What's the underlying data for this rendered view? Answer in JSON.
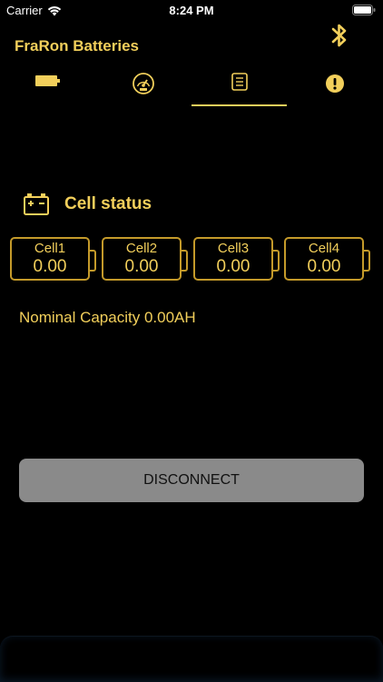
{
  "status_bar": {
    "carrier": "Carrier",
    "time": "8:24 PM"
  },
  "app": {
    "title": "FraRon Batteries"
  },
  "tabs": [
    {
      "icon": "battery-icon",
      "selected": false
    },
    {
      "icon": "gauge-icon",
      "selected": false
    },
    {
      "icon": "list-icon",
      "selected": true
    },
    {
      "icon": "alert-icon",
      "selected": false
    }
  ],
  "cell_status": {
    "title": "Cell status",
    "cells": [
      {
        "label": "Cell1",
        "value": "0.00"
      },
      {
        "label": "Cell2",
        "value": "0.00"
      },
      {
        "label": "Cell3",
        "value": "0.00"
      },
      {
        "label": "Cell4",
        "value": "0.00"
      }
    ]
  },
  "nominal_capacity": "Nominal Capacity 0.00AH",
  "disconnect_label": "DISCONNECT",
  "colors": {
    "accent": "#f2cf5b",
    "cell_border": "#c49a2a",
    "button_bg": "#8a8a8a",
    "background": "#000000"
  }
}
